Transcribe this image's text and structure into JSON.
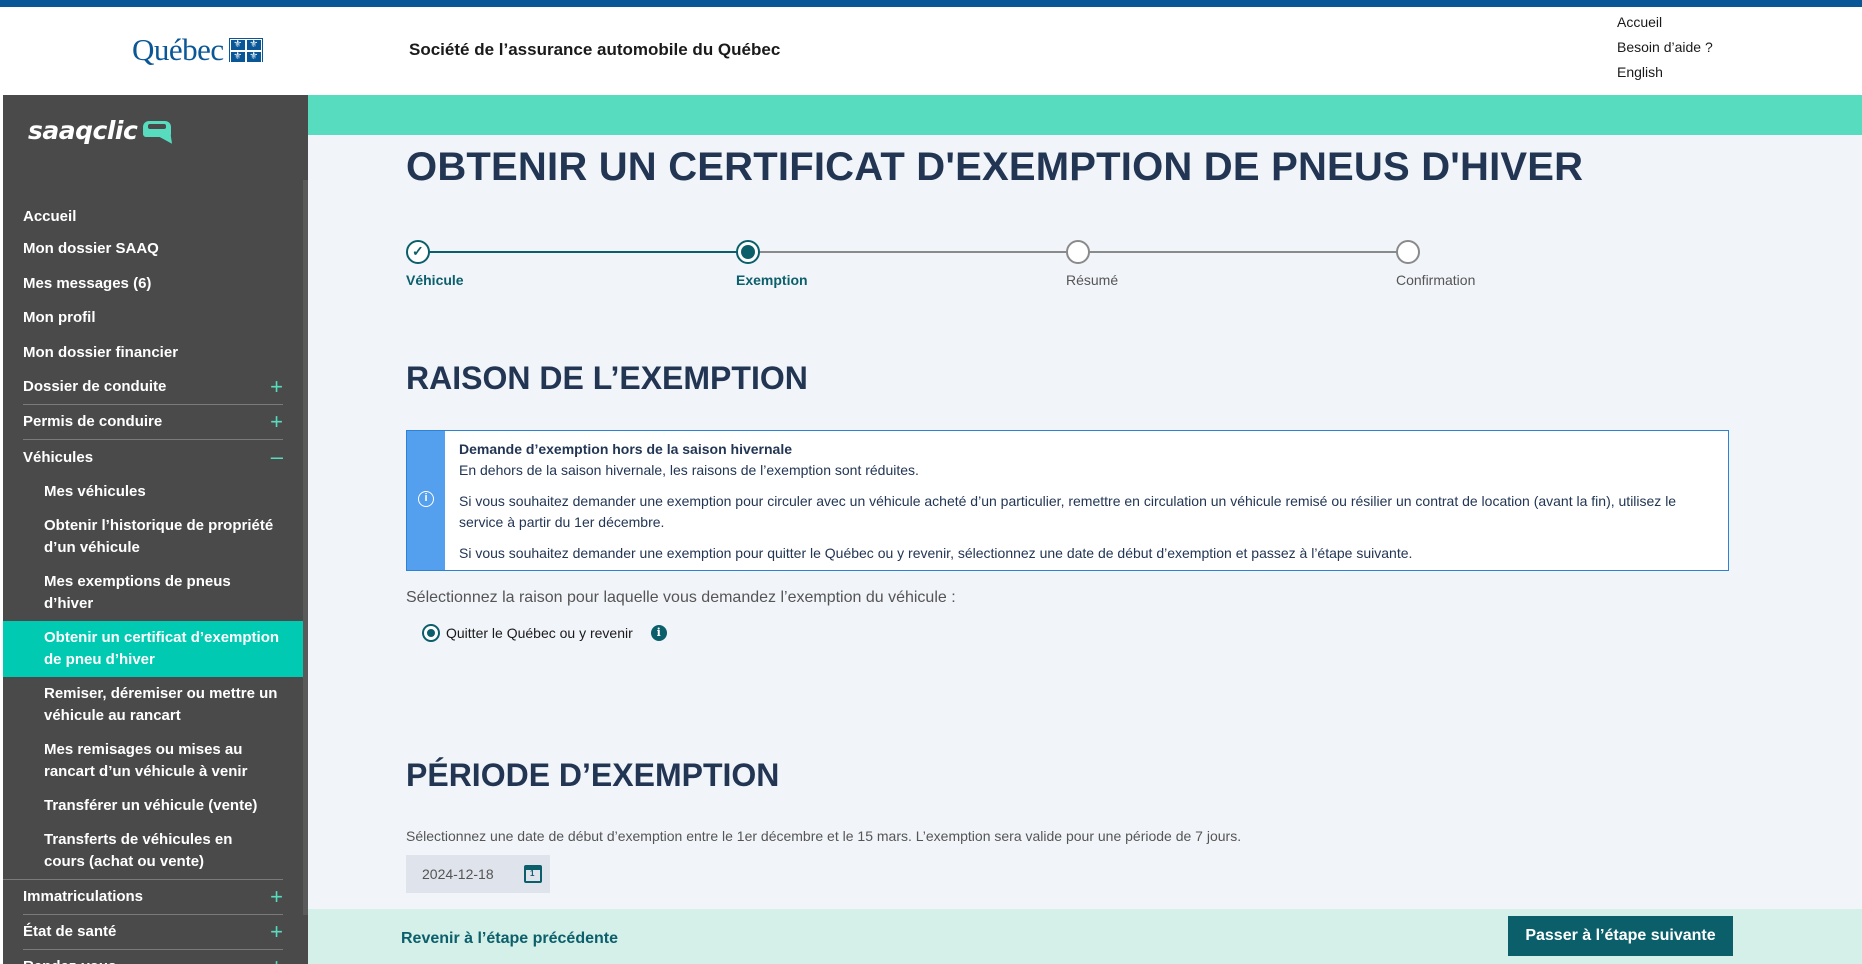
{
  "header": {
    "logo_word": "Québec",
    "org_name": "Société de l’assurance automobile du Québec",
    "links": [
      "Accueil",
      "Besoin d’aide ?",
      "English"
    ]
  },
  "sidebar": {
    "logo_text": "saaqclic",
    "items": [
      {
        "label": "Accueil"
      },
      {
        "label": "Mon dossier SAAQ"
      },
      {
        "label": "Mes messages (6)"
      },
      {
        "label": "Mon profil"
      },
      {
        "label": "Mon dossier financier"
      },
      {
        "label": "Dossier de conduite",
        "toggle": "+"
      },
      {
        "label": "Permis de conduire",
        "toggle": "+"
      },
      {
        "label": "Véhicules",
        "toggle": "–"
      },
      {
        "label": "Mes véhicules"
      },
      {
        "label": "Obtenir l’historique de propriété d’un véhicule"
      },
      {
        "label": "Mes exemptions de pneus d’hiver"
      },
      {
        "label": "Obtenir un certificat d’exemption de pneu d’hiver"
      },
      {
        "label": "Remiser, déremiser ou mettre un véhicule au rancart"
      },
      {
        "label": "Mes remisages ou mises au rancart d’un véhicule à venir"
      },
      {
        "label": "Transférer un véhicule (vente)"
      },
      {
        "label": "Transferts de véhicules en cours (achat ou vente)"
      },
      {
        "label": "Immatriculations",
        "toggle": "+"
      },
      {
        "label": "État de santé",
        "toggle": "+"
      },
      {
        "label": "Rendez-vous",
        "toggle": "+"
      }
    ]
  },
  "main": {
    "title": "OBTENIR UN CERTIFICAT D'EXEMPTION DE PNEUS D'HIVER",
    "steps": [
      {
        "label": "Véhicule",
        "state": "done"
      },
      {
        "label": "Exemption",
        "state": "current"
      },
      {
        "label": "Résumé",
        "state": "todo"
      },
      {
        "label": "Confirmation",
        "state": "todo"
      }
    ],
    "reason_heading": "RAISON DE L’EXEMPTION",
    "info": {
      "title": "Demande d’exemption hors de la saison hivernale",
      "line1": "En dehors de la saison hivernale, les raisons de l’exemption sont réduites.",
      "line2": "Si vous souhaitez demander une exemption pour circuler avec un véhicule acheté d’un particulier, remettre en circulation un véhicule remisé ou résilier un contrat de location (avant la fin), utilisez le service à partir du 1er décembre.",
      "line3": "Si vous souhaitez demander une exemption pour quitter le Québec ou y revenir, sélectionnez une date de début d’exemption et passez à l’étape suivante."
    },
    "question": "Sélectionnez la raison pour laquelle vous demandez l’exemption du véhicule :",
    "radio_label": "Quitter le Québec ou y revenir",
    "period_heading": "PÉRIODE D’EXEMPTION",
    "period_text": "Sélectionnez une date de début d’exemption entre le 1er décembre et le 15 mars. L’exemption sera valide pour une période de 7 jours.",
    "date_value": "2024-12-18"
  },
  "footer": {
    "prev_label": "Revenir à l’étape précédente",
    "next_label": "Passer à l’étape suivante"
  }
}
